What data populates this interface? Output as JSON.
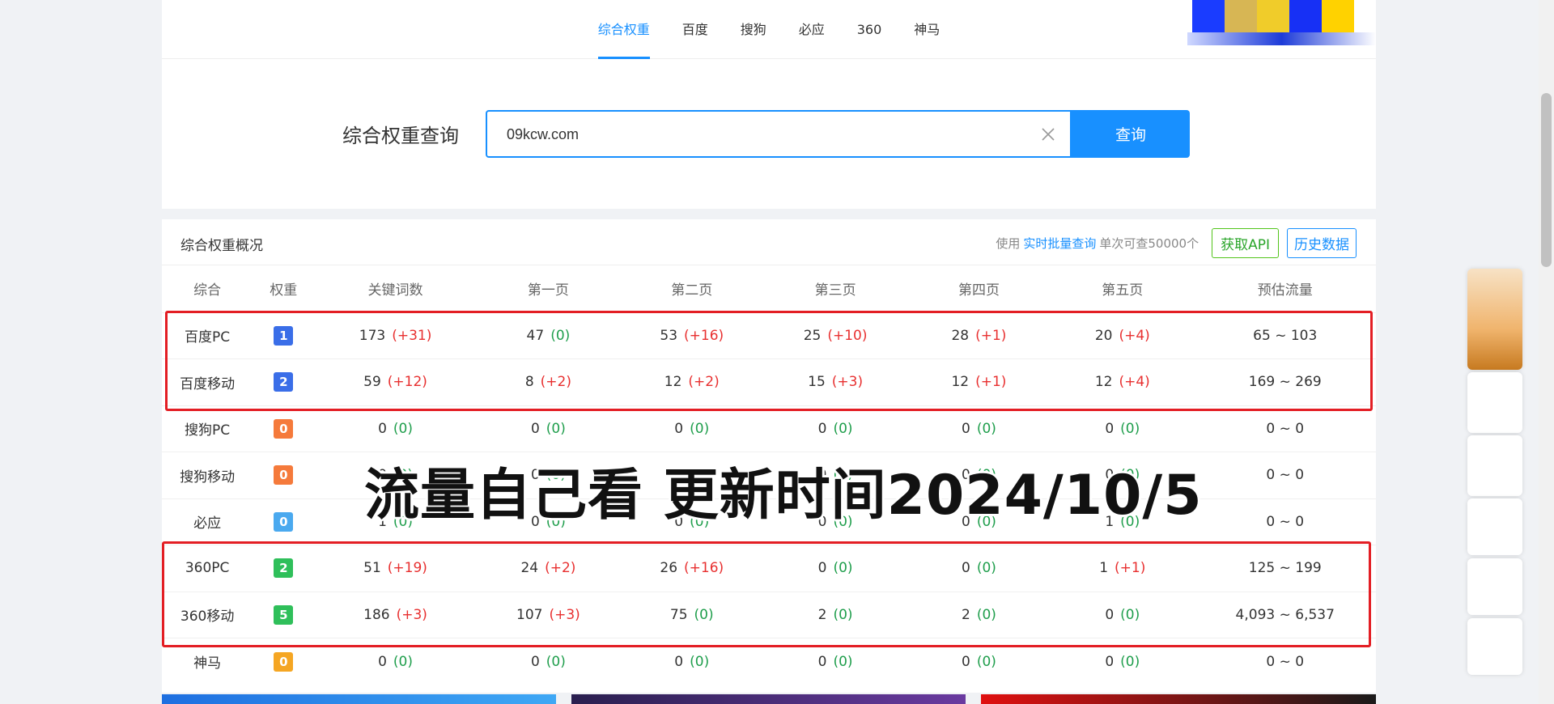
{
  "tabs": [
    "综合权重",
    "百度",
    "搜狗",
    "必应",
    "360",
    "神马"
  ],
  "search": {
    "title": "综合权重查询",
    "value": "09kcw.com",
    "button": "查询"
  },
  "summary": {
    "title": "综合权重概况",
    "note_prefix": "使用",
    "note_link": "实时批量查询",
    "note_suffix": "单次可查50000个",
    "api_button": "获取API",
    "history_button": "历史数据"
  },
  "columns": [
    "综合",
    "权重",
    "关键词数",
    "第一页",
    "第二页",
    "第三页",
    "第四页",
    "第五页",
    "预估流量"
  ],
  "rows": [
    {
      "name": "百度PC",
      "weight": "1",
      "color": "#3a6ee8",
      "cells": [
        [
          "173",
          "(+31)"
        ],
        [
          "47",
          "(0)"
        ],
        [
          "53",
          "(+16)"
        ],
        [
          "25",
          "(+10)"
        ],
        [
          "28",
          "(+1)"
        ],
        [
          "20",
          "(+4)"
        ]
      ],
      "flow": "65 ~ 103"
    },
    {
      "name": "百度移动",
      "weight": "2",
      "color": "#3a6ee8",
      "cells": [
        [
          "59",
          "(+12)"
        ],
        [
          "8",
          "(+2)"
        ],
        [
          "12",
          "(+2)"
        ],
        [
          "15",
          "(+3)"
        ],
        [
          "12",
          "(+1)"
        ],
        [
          "12",
          "(+4)"
        ]
      ],
      "flow": "169 ~ 269"
    },
    {
      "name": "搜狗PC",
      "weight": "0",
      "color": "#f57a3b",
      "cells": [
        [
          "0",
          "(0)"
        ],
        [
          "0",
          "(0)"
        ],
        [
          "0",
          "(0)"
        ],
        [
          "0",
          "(0)"
        ],
        [
          "0",
          "(0)"
        ],
        [
          "0",
          "(0)"
        ]
      ],
      "flow": "0 ~ 0"
    },
    {
      "name": "搜狗移动",
      "weight": "0",
      "color": "#f57a3b",
      "cells": [
        [
          "0",
          "(0)"
        ],
        [
          "0",
          "(0)"
        ],
        [
          "0",
          "(0)"
        ],
        [
          "0",
          "(0)"
        ],
        [
          "0",
          "(0)"
        ],
        [
          "0",
          "(0)"
        ]
      ],
      "flow": "0 ~ 0"
    },
    {
      "name": "必应",
      "weight": "0",
      "color": "#4aa9ef",
      "cells": [
        [
          "1",
          "(0)"
        ],
        [
          "0",
          "(0)"
        ],
        [
          "0",
          "(0)"
        ],
        [
          "0",
          "(0)"
        ],
        [
          "0",
          "(0)"
        ],
        [
          "1",
          "(0)"
        ]
      ],
      "flow": "0 ~ 0"
    },
    {
      "name": "360PC",
      "weight": "2",
      "color": "#2fbf5a",
      "cells": [
        [
          "51",
          "(+19)"
        ],
        [
          "24",
          "(+2)"
        ],
        [
          "26",
          "(+16)"
        ],
        [
          "0",
          "(0)"
        ],
        [
          "0",
          "(0)"
        ],
        [
          "1",
          "(+1)"
        ]
      ],
      "flow": "125 ~ 199"
    },
    {
      "name": "360移动",
      "weight": "5",
      "color": "#2fbf5a",
      "cells": [
        [
          "186",
          "(+3)"
        ],
        [
          "107",
          "(+3)"
        ],
        [
          "75",
          "(0)"
        ],
        [
          "2",
          "(0)"
        ],
        [
          "2",
          "(0)"
        ],
        [
          "0",
          "(0)"
        ]
      ],
      "flow": "4,093 ~ 6,537"
    },
    {
      "name": "神马",
      "weight": "0",
      "color": "#f5a623",
      "cells": [
        [
          "0",
          "(0)"
        ],
        [
          "0",
          "(0)"
        ],
        [
          "0",
          "(0)"
        ],
        [
          "0",
          "(0)"
        ],
        [
          "0",
          "(0)"
        ],
        [
          "0",
          "(0)"
        ]
      ],
      "flow": "0 ~ 0"
    }
  ],
  "overlay": "流量自己看  更新时间2024/10/5",
  "colors": {
    "accent": "#1890ff",
    "highlight_box": "#e31e24",
    "increase": "#e83030",
    "no_change": "#1f9e4c"
  }
}
